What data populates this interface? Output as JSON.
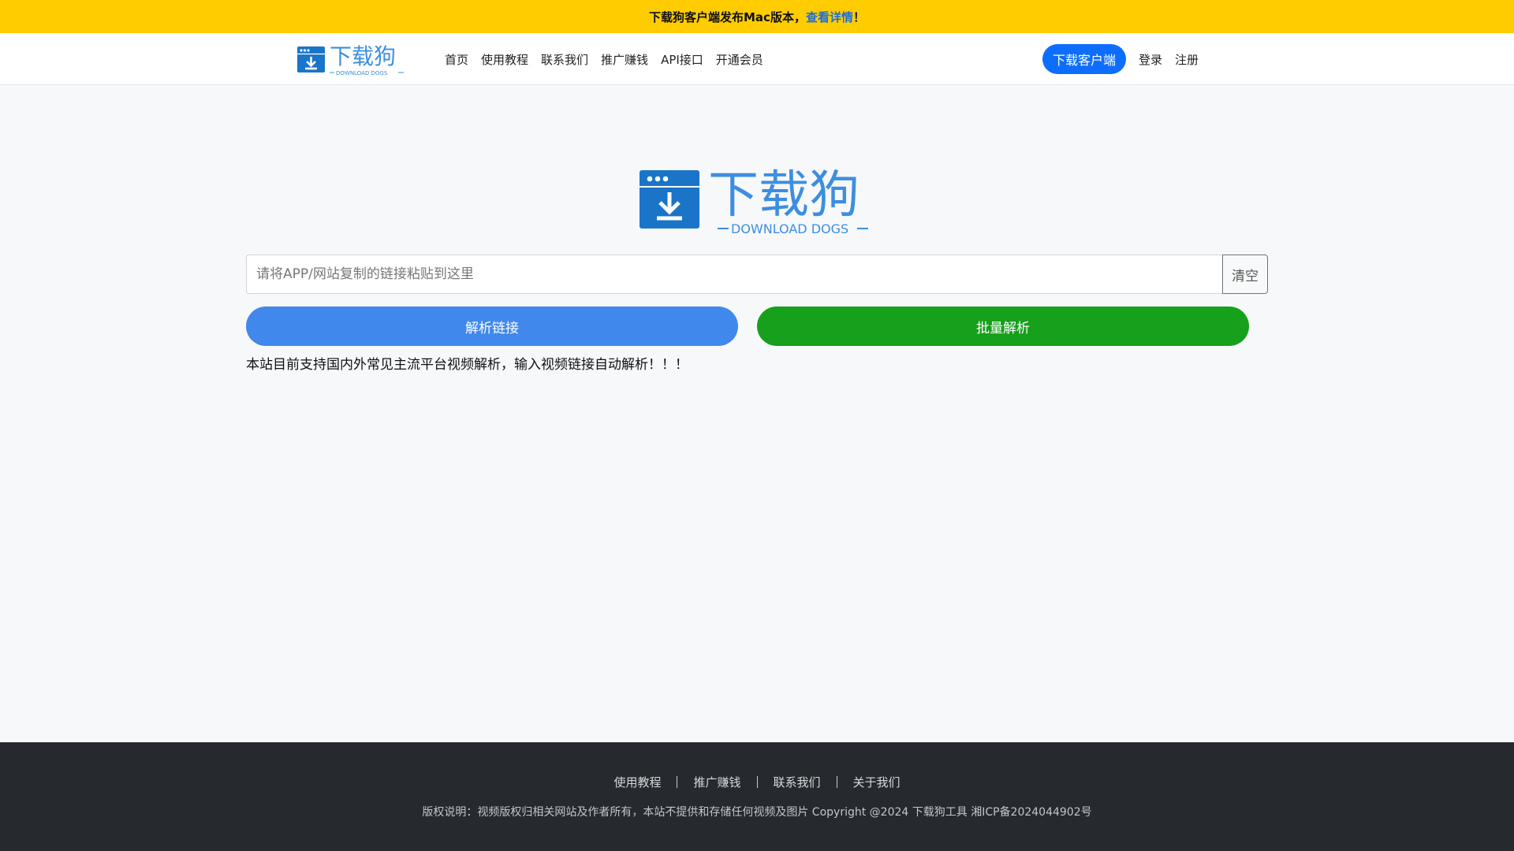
{
  "announcement": {
    "text": "下载狗客户端发布Mac版本，",
    "link": "查看详情",
    "suffix": "！"
  },
  "nav": {
    "links": [
      "首页",
      "使用教程",
      "联系我们",
      "推广赚钱",
      "API接口",
      "开通会员"
    ],
    "client_button": "下载客户端",
    "login": "登录",
    "register": "注册"
  },
  "logo": {
    "name": "下载狗",
    "tagline": "DOWNLOAD DOGS"
  },
  "search": {
    "placeholder": "请将APP/网站复制的链接粘贴到这里",
    "clear_label": "清空"
  },
  "actions": {
    "parse_label": "解析链接",
    "batch_label": "批量解析"
  },
  "notice": "本站目前支持国内外常见主流平台视频解析，输入视频链接自动解析！！！",
  "footer": {
    "links": [
      "使用教程",
      "推广赚钱",
      "联系我们",
      "关于我们"
    ],
    "copyright": "版权说明：视频版权归相关网站及作者所有，本站不提供和存储任何视频及图片 Copyright @2024 下载狗工具 湘ICP备2024044902号"
  },
  "colors": {
    "announce_bg": "#ffcc00",
    "primary": "#0d6efd",
    "parse": "#4088ec",
    "batch": "#17a01b",
    "logo_blue": "#1a74c8",
    "logo_text": "#3d8ee0",
    "footer_bg": "#26292e"
  }
}
